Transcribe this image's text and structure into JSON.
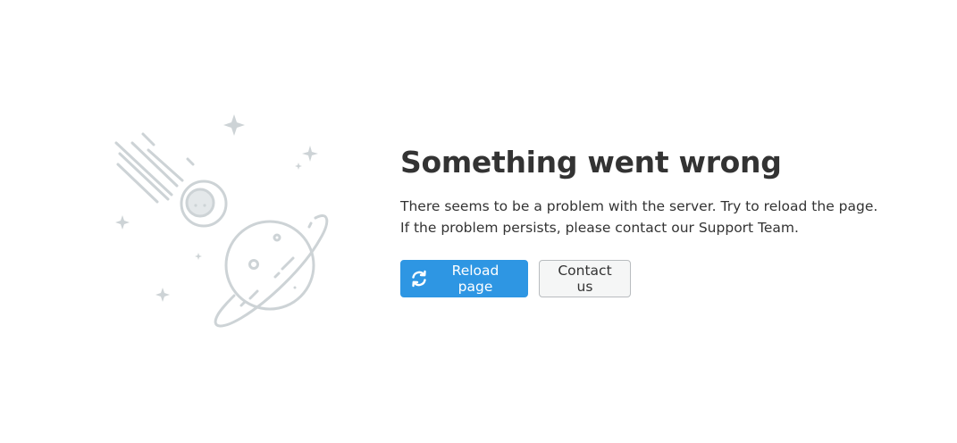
{
  "error": {
    "title": "Something went wrong",
    "message_line1": "There seems to be a problem with the server. Try to reload the page.",
    "message_line2": "If the problem persists, please contact our Support Team."
  },
  "actions": {
    "reload_label": "Reload page",
    "reload_icon": "reload-icon",
    "contact_label": "Contact us"
  },
  "illustration": {
    "name": "meteor-and-planet-illustration",
    "color": "#cdd3d6"
  },
  "colors": {
    "primary": "#2e96e3",
    "text": "#333333",
    "secondary_border": "#b8bcbf",
    "secondary_bg": "#f5f6f6"
  }
}
